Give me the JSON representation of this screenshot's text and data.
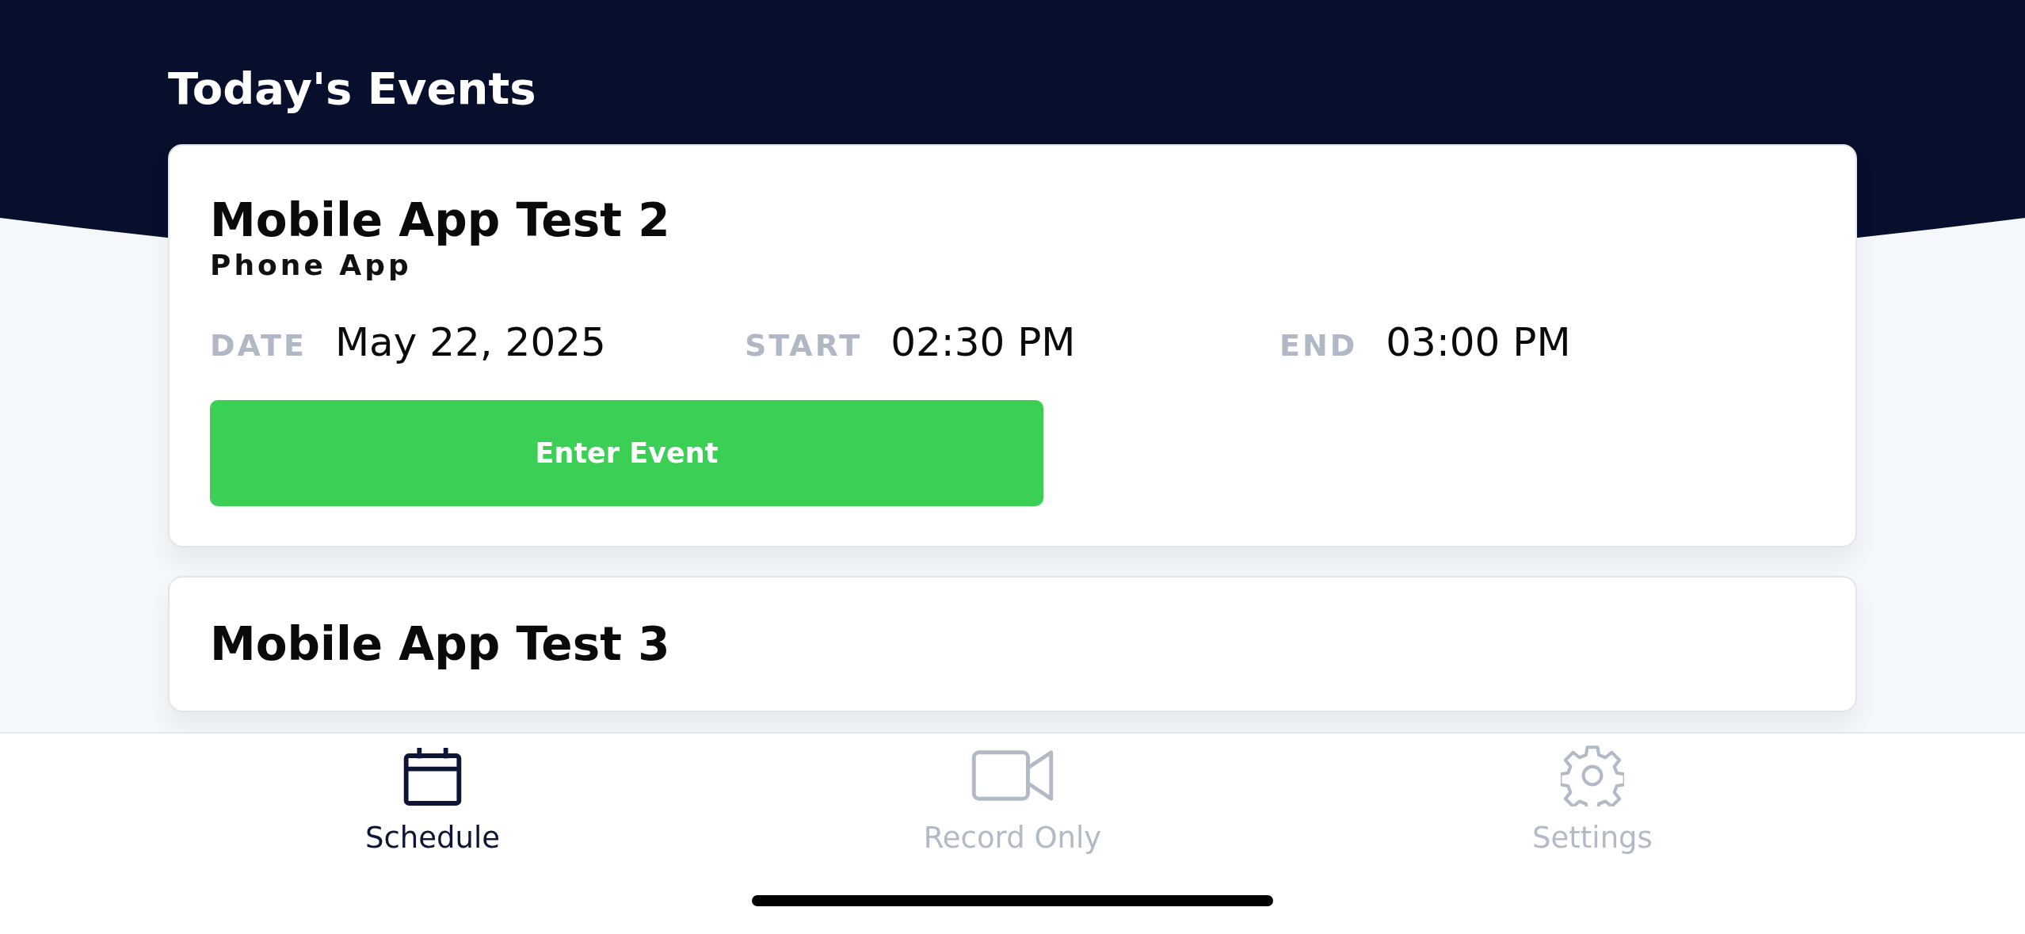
{
  "header": {
    "title": "Today's Events"
  },
  "events": [
    {
      "title": "Mobile App Test 2",
      "subtitle": "Phone App",
      "fields": [
        {
          "label": "DATE",
          "value": "May 22, 2025"
        },
        {
          "label": "START",
          "value": "02:30 PM"
        },
        {
          "label": "END",
          "value": "03:00 PM"
        }
      ],
      "button": "Enter Event"
    },
    {
      "title": "Mobile App Test 3"
    }
  ],
  "tabs": [
    {
      "kind": "calendar",
      "label": "Schedule",
      "selected": true
    },
    {
      "kind": "video",
      "label": "Record Only",
      "selected": false
    },
    {
      "kind": "gear",
      "label": "Settings",
      "selected": false
    }
  ]
}
